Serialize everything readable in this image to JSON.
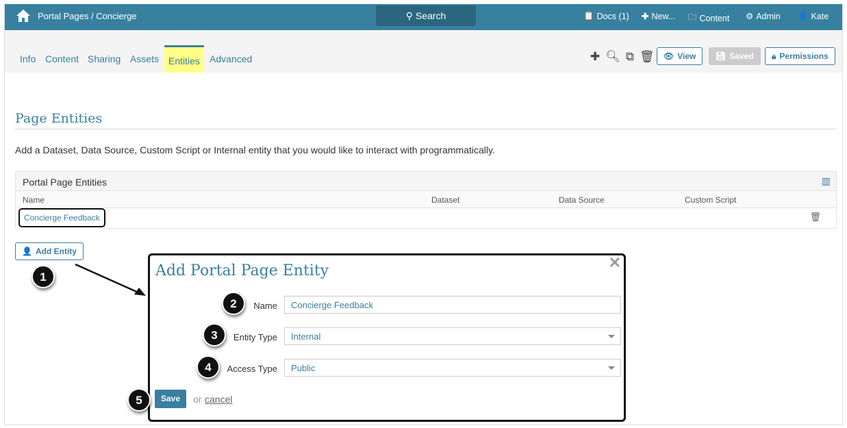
{
  "topbar": {
    "breadcrumb": "Portal Pages / Concierge",
    "search": "Search",
    "docs": "Docs (1)",
    "new": "New...",
    "content": "Content",
    "admin": "Admin",
    "user": "Kate"
  },
  "tabs": [
    "Info",
    "Content",
    "Sharing",
    "Assets",
    "Entities",
    "Advanced"
  ],
  "toolbar": {
    "view": "View",
    "saved": "Saved",
    "permissions": "Permissions"
  },
  "page": {
    "title": "Page Entities",
    "description": "Add a Dataset, Data Source, Custom Script or Internal entity that you would like to interact with programmatically."
  },
  "table": {
    "title": "Portal Page Entities",
    "columns": [
      "Name",
      "Dataset",
      "Data Source",
      "Custom Script"
    ],
    "rows": [
      {
        "name": "Concierge Feedback"
      }
    ]
  },
  "add_entity": "Add Entity",
  "modal": {
    "title": "Add Portal Page Entity",
    "name_label": "Name",
    "name_value": "Concierge Feedback",
    "entity_type_label": "Entity Type",
    "entity_type_value": "Internal",
    "access_type_label": "Access Type",
    "access_type_value": "Public",
    "save": "Save",
    "or": "or",
    "cancel": "cancel"
  },
  "callouts": [
    "1",
    "2",
    "3",
    "4",
    "5"
  ]
}
